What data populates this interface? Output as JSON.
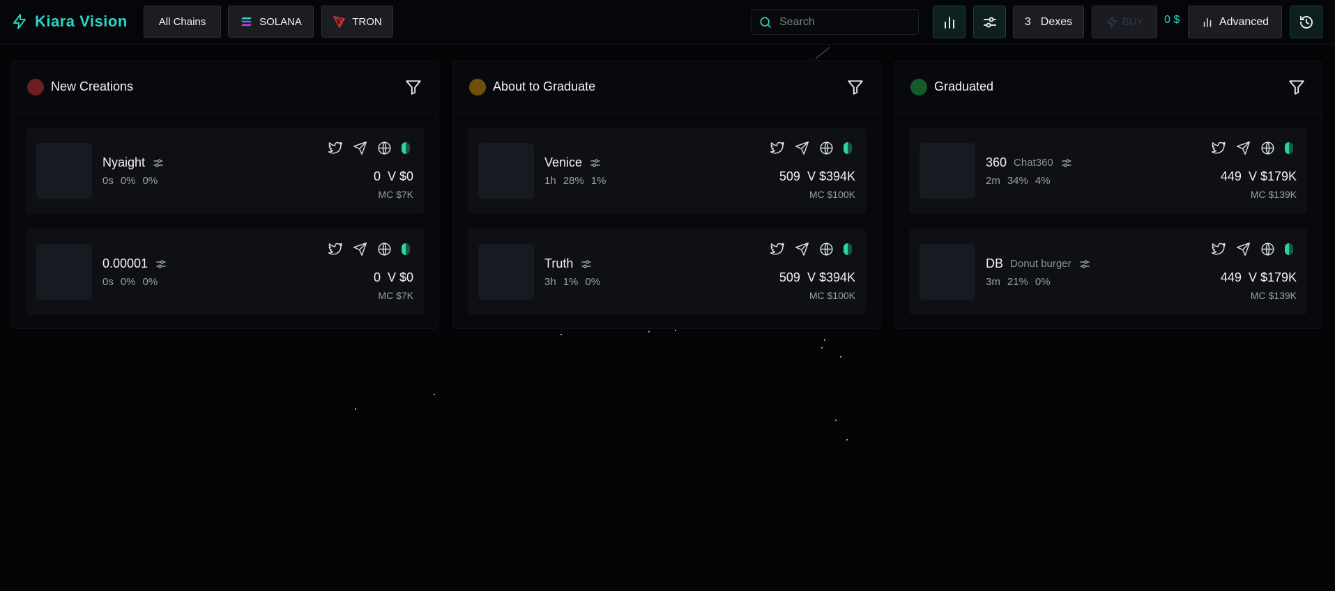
{
  "header": {
    "app_name": "Kiara Vision",
    "chains": [
      "All Chains",
      "SOLANA",
      "TRON"
    ],
    "search_placeholder": "Search",
    "dex_count": "3",
    "dex_label": "Dexes",
    "buy_label": "BUY",
    "balance": "0 $",
    "advanced_label": "Advanced"
  },
  "columns": [
    {
      "title": "New Creations",
      "dot_color": "#6b1f1f",
      "cards": [
        {
          "name": "Nyaight",
          "sub": "",
          "age": "0s",
          "pct1": "0%",
          "pct2": "0%",
          "count": "0",
          "volume": "V $0",
          "mc": "MC $7K"
        },
        {
          "name": "0.00001",
          "sub": "",
          "age": "0s",
          "pct1": "0%",
          "pct2": "0%",
          "count": "0",
          "volume": "V $0",
          "mc": "MC $7K"
        }
      ]
    },
    {
      "title": "About to Graduate",
      "dot_color": "#6e4f0c",
      "cards": [
        {
          "name": "Venice",
          "sub": "",
          "age": "1h",
          "pct1": "28%",
          "pct2": "1%",
          "count": "509",
          "volume": "V $394K",
          "mc": "MC $100K"
        },
        {
          "name": "Truth",
          "sub": "",
          "age": "3h",
          "pct1": "1%",
          "pct2": "0%",
          "count": "509",
          "volume": "V $394K",
          "mc": "MC $100K"
        }
      ]
    },
    {
      "title": "Graduated",
      "dot_color": "#145a2a",
      "cards": [
        {
          "name": "360",
          "sub": "Chat360",
          "age": "2m",
          "pct1": "34%",
          "pct2": "4%",
          "count": "449",
          "volume": "V $179K",
          "mc": "MC $139K"
        },
        {
          "name": "DB",
          "sub": "Donut burger",
          "age": "3m",
          "pct1": "21%",
          "pct2": "0%",
          "count": "449",
          "volume": "V $179K",
          "mc": "MC $139K"
        }
      ]
    }
  ],
  "colors": {
    "accent": "#2ed3c6",
    "pill_left": "#2ed3a0",
    "pill_right": "#0f5b47"
  },
  "icons": [
    "lightning-icon",
    "solana-icon",
    "tron-icon",
    "search-icon",
    "bar-chart-icon",
    "sliders-icon",
    "bolt-icon",
    "history-icon",
    "filter-icon",
    "twitter-icon",
    "telegram-icon",
    "globe-icon",
    "tune-icon"
  ]
}
